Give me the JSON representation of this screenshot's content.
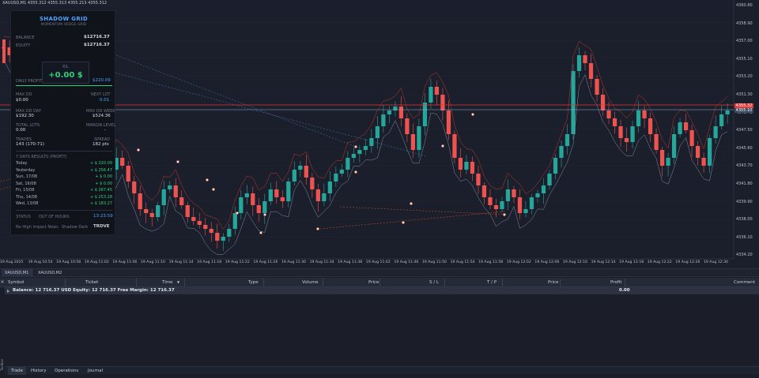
{
  "chart": {
    "symbol_info": "XAUUSD,M1  4355.312 4355.313 4355.213 4355.312",
    "price_axis": [
      "4360.80",
      "4358.90",
      "4357.00",
      "4355.10",
      "4353.20",
      "4351.30",
      "4349.40",
      "4347.50",
      "4345.60",
      "4343.70",
      "4341.80",
      "4339.90",
      "4338.00",
      "4336.10",
      "4334.20"
    ],
    "price_tag_red": "4355.32",
    "price_tag_blue": "4355.10",
    "time_axis": [
      "19 Aug 2025",
      "19 Aug 10:54",
      "19 Aug 10:58",
      "19 Aug 11:02",
      "19 Aug 11:06",
      "19 Aug 11:10",
      "19 Aug 11:14",
      "19 Aug 11:18",
      "19 Aug 11:22",
      "19 Aug 11:26",
      "19 Aug 11:30",
      "19 Aug 11:34",
      "19 Aug 11:38",
      "19 Aug 11:42",
      "19 Aug 11:46",
      "19 Aug 11:50",
      "19 Aug 11:54",
      "19 Aug 11:58",
      "19 Aug 12:02",
      "19 Aug 12:06",
      "19 Aug 12:10",
      "19 Aug 12:14",
      "19 Aug 12:18",
      "19 Aug 12:22",
      "19 Aug 12:26",
      "19 Aug 12:30"
    ],
    "colors": {
      "bull": "#26a69a",
      "bear": "#ef5350",
      "hline_red": "#e53935",
      "hline_blue": "#8fb4d9"
    }
  },
  "panel": {
    "title": "SHADOW GRID",
    "subtitle": "MOMENTUM HEDGE GRID",
    "balance_label": "BALANCE",
    "balance_value": "$12716.37",
    "equity_label": "EQUITY",
    "equity_value": "$12716.37",
    "pnl_label": "P/L",
    "pnl_value": "+0.00 $",
    "daily_profit_label": "DAILY PROFIT",
    "daily_profit_value": "$220.09",
    "max_dd_label": "MAX DD",
    "max_dd_value": "$0.00",
    "next_lot_label": "NEXT LOT",
    "next_lot_value": "0.01",
    "max_dd_day_label": "MAX DD DAY",
    "max_dd_day_value": "$192.30",
    "max_dd_week_label": "MAX DD WEEK",
    "max_dd_week_value": "$524.36",
    "total_lots_label": "TOTAL LOTS",
    "total_lots_value": "0.00",
    "margin_level_label": "MARGIN LEVEL",
    "margin_level_value": "-",
    "trades_label": "TRADES",
    "trades_value": "143 (170-71)",
    "spread_label": "SPREAD",
    "spread_value": "182 pts",
    "history_label": "7 DAYS RESULTS (PROFIT)",
    "days": [
      {
        "day": "Today",
        "value": "+ $ 220.09"
      },
      {
        "day": "Yesterday",
        "value": "+ $ 256.47"
      },
      {
        "day": "Sun, 17/08",
        "value": "+ $ 0.00"
      },
      {
        "day": "Sat, 16/08",
        "value": "+ $ 0.00"
      },
      {
        "day": "Fri, 15/08",
        "value": "+ $ 267.45"
      },
      {
        "day": "Thu, 14/08",
        "value": "+ $ 253.28"
      },
      {
        "day": "Wed, 13/08",
        "value": "+ $ 183.27"
      }
    ],
    "status_label": "STATUS",
    "status_value": "OUT OF HOURS",
    "clock_value": "13:23:59",
    "footer_left": "No High Impact News",
    "footer_mid": "Shadow Dark",
    "footer_brand": "TRDVE"
  },
  "chart_tabs": [
    {
      "label": "XAUUSD,M1",
      "active": true
    },
    {
      "label": "XAUUSD,M2",
      "active": false
    }
  ],
  "terminal": {
    "columns": [
      "Symbol",
      "Ticket",
      "Time",
      "Type",
      "Volume",
      "Price",
      "S / L",
      "T / P",
      "Price",
      "Profit",
      "Comment"
    ],
    "balance_text": "Balance: 12 716.37 USD  Equity: 12 716.37  Free Margin: 12 716.37",
    "balance_profit": "0.00",
    "tabs": [
      {
        "label": "Trade",
        "active": true
      },
      {
        "label": "History",
        "active": false
      },
      {
        "label": "Operations",
        "active": false
      },
      {
        "label": "Journal",
        "active": false
      }
    ],
    "toolbox_label": "Toolbox"
  }
}
